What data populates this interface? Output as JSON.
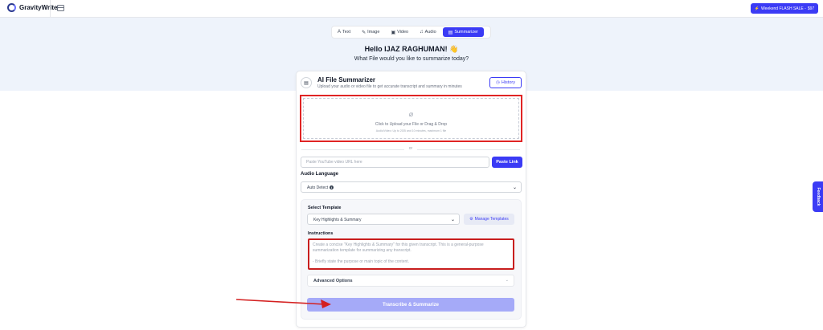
{
  "app": {
    "name": "GravityWrite"
  },
  "promo": {
    "label": "Weekend FLASH SALE - ",
    "price": "$97",
    "icon": "bolt-icon"
  },
  "tabs": [
    {
      "label": "Text",
      "icon": "text-icon"
    },
    {
      "label": "Image",
      "icon": "image-icon"
    },
    {
      "label": "Video",
      "icon": "video-icon"
    },
    {
      "label": "Audio",
      "icon": "audio-icon"
    },
    {
      "label": "Summarizer",
      "icon": "document-icon",
      "active": true
    }
  ],
  "hero": {
    "greeting": "Hello IJAZ RAGHUMAN! 👋",
    "subtitle": "What File would you like to summarize today?"
  },
  "summarizer": {
    "title": "AI File Summarizer",
    "subtitle": "Upload your audio or video file to get accurate transcript and summary in minutes",
    "history_label": "History",
    "upload_text": "Click to Upload your File or Drag & Drop",
    "upload_note": "Audio/Video: Up to 2GB and 10 minutes, maximum 1 file",
    "or_text": "or",
    "youtube_placeholder": "Paste YouTube video URL here",
    "paste_label": "Paste Link",
    "language_label": "Audio Language",
    "language_value": "Auto Detect",
    "template_label": "Select Template",
    "template_value": "Key Highlights & Summary",
    "manage_label": "Manage Templates",
    "instructions_label": "Instructions",
    "instructions_line1": "Create a concise \"Key Highlights & Summary\" for this given transcript. This is a general-purpose summarization template for summarizing any transcript.",
    "instructions_line2": "- Briefly state the purpose or main topic of the content.",
    "advanced_label": "Advanced Options",
    "submit_label": "Transcribe & Summarize"
  },
  "feedback_label": "Feedback",
  "colors": {
    "accent": "#3b3bf5",
    "highlight": "#e02424",
    "hero_bg": "#eef3fb"
  }
}
